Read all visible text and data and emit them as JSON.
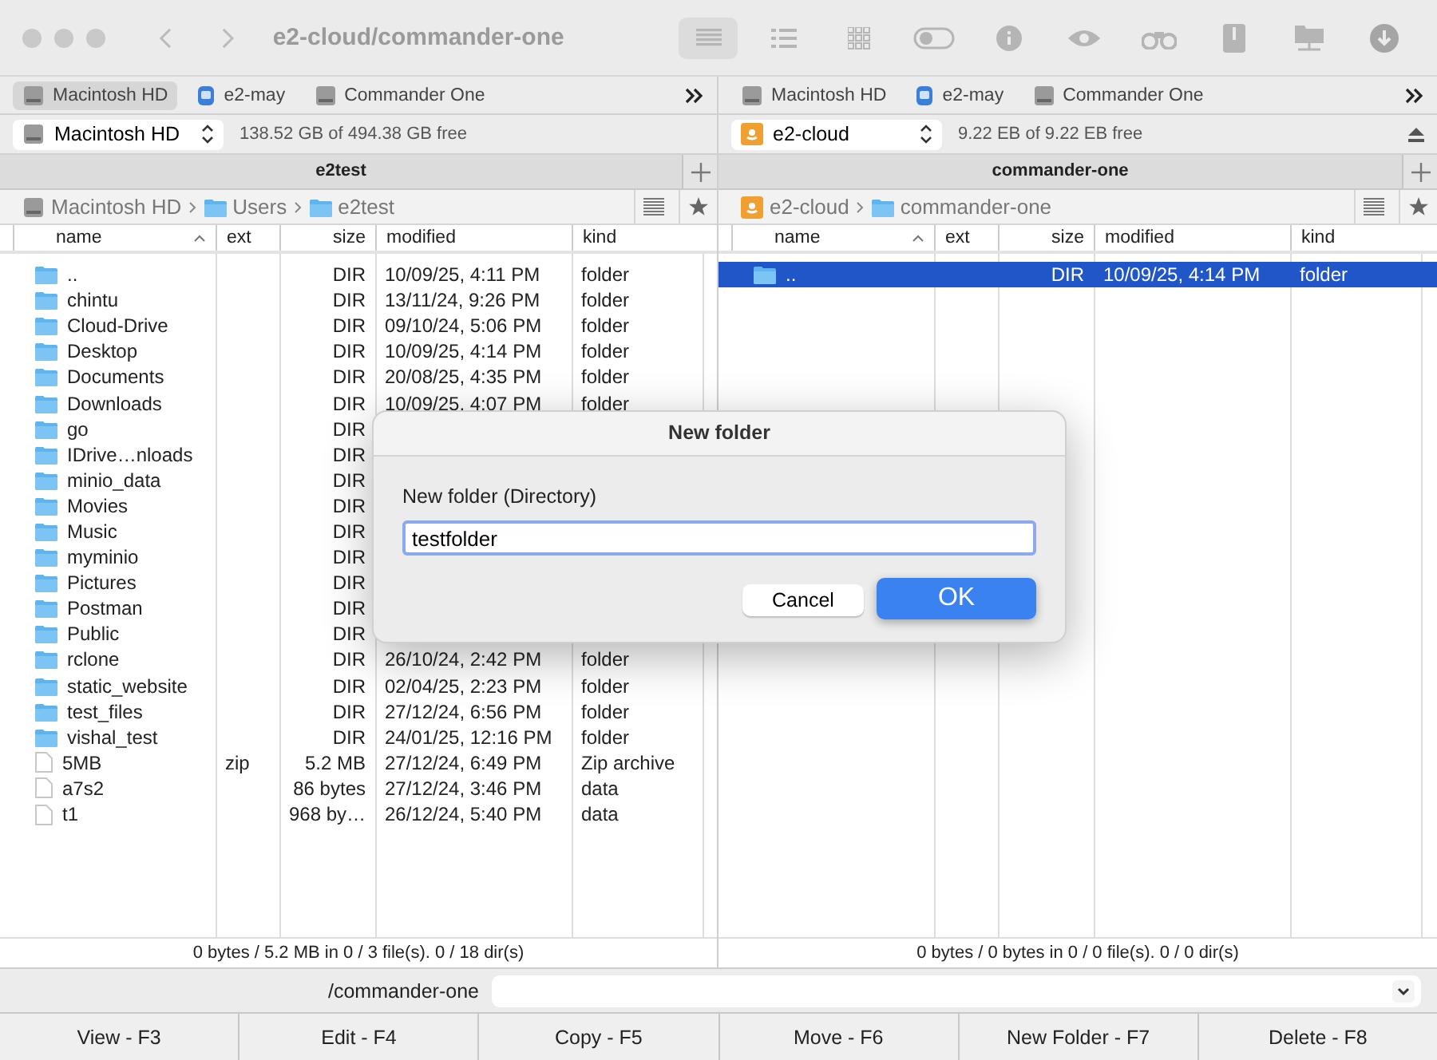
{
  "window": {
    "title": "e2-cloud/commander-one"
  },
  "view_buttons": [
    {
      "selected": true
    },
    {
      "selected": false
    },
    {
      "selected": false
    }
  ],
  "panels": [
    {
      "favorites": [
        {
          "label": "Macintosh HD",
          "kind": "disk",
          "selected": true
        },
        {
          "label": "e2-may",
          "kind": "network",
          "selected": false
        },
        {
          "label": "Commander One",
          "kind": "disk",
          "selected": false
        }
      ],
      "drive": {
        "name": "Macintosh HD",
        "kind": "disk",
        "free": "138.52 GB of 494.38 GB free"
      },
      "title": "e2test",
      "path": [
        {
          "label": "Macintosh HD",
          "kind": "disk"
        },
        {
          "label": "Users",
          "kind": "folder"
        },
        {
          "label": "e2test",
          "kind": "folder"
        }
      ],
      "columns": [
        "name",
        "ext",
        "size",
        "modified",
        "kind"
      ],
      "rows": [
        {
          "kind": "folder",
          "name": "..",
          "size": "DIR",
          "modified": "10/09/25, 4:11 PM",
          "file_kind": "folder",
          "selected": false
        },
        {
          "kind": "folder",
          "name": "chintu",
          "size": "DIR",
          "modified": "13/11/24, 9:26 PM",
          "file_kind": "folder",
          "selected": false
        },
        {
          "kind": "folder",
          "name": "Cloud-Drive",
          "size": "DIR",
          "modified": "09/10/24, 5:06 PM",
          "file_kind": "folder",
          "selected": false
        },
        {
          "kind": "folder",
          "name": "Desktop",
          "size": "DIR",
          "modified": "10/09/25, 4:14 PM",
          "file_kind": "folder",
          "selected": false
        },
        {
          "kind": "folder",
          "name": "Documents",
          "size": "DIR",
          "modified": "20/08/25, 4:35 PM",
          "file_kind": "folder",
          "selected": false
        },
        {
          "kind": "folder",
          "name": "Downloads",
          "size": "DIR",
          "modified": "10/09/25, 4:07 PM",
          "file_kind": "folder",
          "selected": false
        },
        {
          "kind": "folder",
          "name": "go",
          "size": "DIR",
          "selected": false
        },
        {
          "kind": "folder",
          "name": "IDrive…nloads",
          "size": "DIR",
          "selected": false
        },
        {
          "kind": "folder",
          "name": "minio_data",
          "size": "DIR",
          "selected": false
        },
        {
          "kind": "folder",
          "name": "Movies",
          "size": "DIR",
          "selected": false
        },
        {
          "kind": "folder",
          "name": "Music",
          "size": "DIR",
          "selected": false
        },
        {
          "kind": "folder",
          "name": "myminio",
          "size": "DIR",
          "selected": false
        },
        {
          "kind": "folder",
          "name": "Pictures",
          "size": "DIR",
          "selected": false
        },
        {
          "kind": "folder",
          "name": "Postman",
          "size": "DIR",
          "selected": false
        },
        {
          "kind": "folder",
          "name": "Public",
          "size": "DIR",
          "selected": false
        },
        {
          "kind": "folder",
          "name": "rclone",
          "size": "DIR",
          "modified": "26/10/24, 2:42 PM",
          "file_kind": "folder",
          "selected": false
        },
        {
          "kind": "folder",
          "name": "static_website",
          "size": "DIR",
          "modified": "02/04/25, 2:23 PM",
          "file_kind": "folder",
          "selected": false
        },
        {
          "kind": "folder",
          "name": "test_files",
          "size": "DIR",
          "modified": "27/12/24, 6:56 PM",
          "file_kind": "folder",
          "selected": false
        },
        {
          "kind": "folder",
          "name": "vishal_test",
          "size": "DIR",
          "modified": "24/01/25, 12:16 PM",
          "file_kind": "folder",
          "selected": false
        },
        {
          "kind": "archive",
          "name": "5MB",
          "ext": "zip",
          "size": "5.2 MB",
          "modified": "27/12/24, 6:49 PM",
          "file_kind": "Zip archive",
          "selected": false
        },
        {
          "kind": "file",
          "name": "a7s2",
          "size": "86 bytes",
          "modified": "27/12/24, 3:46 PM",
          "file_kind": "data",
          "selected": false
        },
        {
          "kind": "file",
          "name": "t1",
          "size": "968 by…",
          "modified": "26/12/24, 5:40 PM",
          "file_kind": "data",
          "selected": false
        }
      ],
      "status": "0 bytes / 5.2 MB in 0 / 3 file(s). 0 / 18 dir(s)"
    },
    {
      "favorites": [
        {
          "label": "Macintosh HD",
          "kind": "disk",
          "selected": false
        },
        {
          "label": "e2-may",
          "kind": "network",
          "selected": false
        },
        {
          "label": "Commander One",
          "kind": "disk",
          "selected": false
        }
      ],
      "drive": {
        "name": "e2-cloud",
        "kind": "cloud",
        "free": "9.22 EB of 9.22 EB free"
      },
      "title": "commander-one",
      "path": [
        {
          "label": "e2-cloud",
          "kind": "cloud"
        },
        {
          "label": "commander-one",
          "kind": "folder"
        }
      ],
      "columns": [
        "name",
        "ext",
        "size",
        "modified",
        "kind"
      ],
      "rows": [
        {
          "kind": "folder",
          "name": "..",
          "size": "DIR",
          "modified": "10/09/25, 4:14 PM",
          "file_kind": "folder",
          "selected": true
        }
      ],
      "status": "0 bytes / 0 bytes in 0 / 0 file(s). 0 / 0 dir(s)"
    }
  ],
  "command_line": {
    "path": "/commander-one"
  },
  "function_keys": [
    "View - F3",
    "Edit - F4",
    "Copy - F5",
    "Move - F6",
    "New Folder - F7",
    "Delete - F8"
  ],
  "dialog": {
    "title": "New folder",
    "label": "New folder (Directory)",
    "value": "testfolder",
    "buttons": [
      {
        "label": "Cancel",
        "kind": "normal"
      },
      {
        "label": "OK",
        "kind": "default"
      }
    ]
  }
}
